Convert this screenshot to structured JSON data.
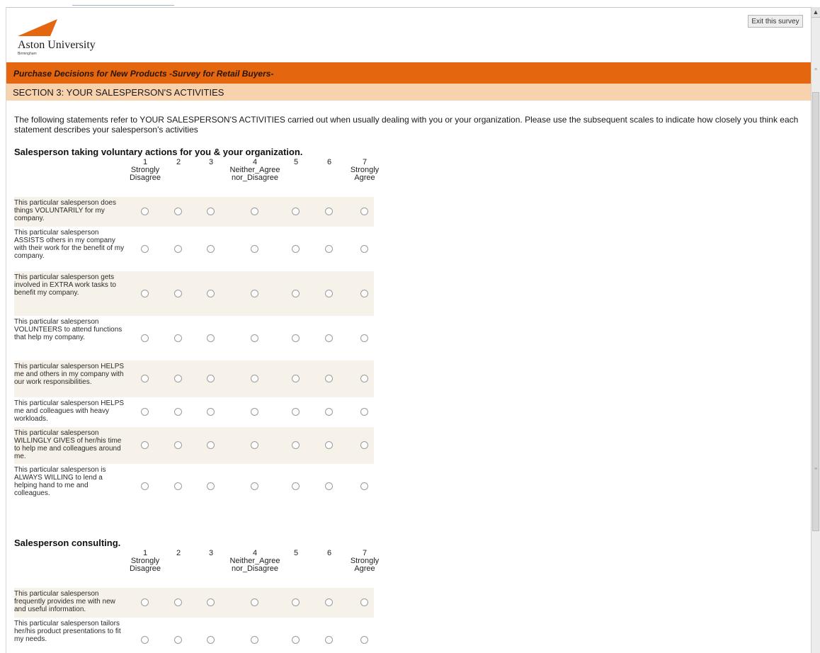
{
  "logo": {
    "name": "Aston University",
    "city": "Birmingham"
  },
  "exit_button": "Exit this survey",
  "survey_title": "Purchase Decisions for New Products -Survey for Retail Buyers-",
  "section_title": "SECTION 3: YOUR SALESPERSON'S ACTIVITIES",
  "intro_text": "The following statements refer to YOUR SALESPERSON'S ACTIVITIES carried out when usually dealing with you or your organization. Please use the subsequent scales to indicate how closely you think each statement describes your salesperson's activities",
  "scale": [
    {
      "num": "1",
      "label": "Strongly Disagree"
    },
    {
      "num": "2",
      "label": ""
    },
    {
      "num": "3",
      "label": ""
    },
    {
      "num": "4",
      "label": "Neither_Agree nor_Disagree"
    },
    {
      "num": "5",
      "label": ""
    },
    {
      "num": "6",
      "label": ""
    },
    {
      "num": "7",
      "label": "Strongly Agree"
    }
  ],
  "question_1": {
    "title": "Salesperson taking voluntary actions for you & your organization.",
    "statements": [
      "This particular salesperson does things VOLUNTARILY for my company.",
      "This particular salesperson ASSISTS others in my company with their work for the benefit of my company.",
      "This particular salesperson gets involved in EXTRA work tasks to benefit my company.",
      "This particular salesperson VOLUNTEERS to attend functions that help my company.",
      "This particular salesperson HELPS me and others in my company with our work responsibilities.",
      "This particular salesperson HELPS me and colleagues with heavy workloads.",
      "This particular salesperson WILLINGLY GIVES of her/his time to help me and colleagues around me.",
      "This particular salesperson is ALWAYS WILLING to lend a helping hand to me and colleagues."
    ]
  },
  "question_2": {
    "title": "Salesperson consulting.",
    "statements": [
      "This particular salesperson frequently provides me with new and useful information.",
      "This particular salesperson tailors her/his product presentations to fit my needs."
    ]
  },
  "colors": {
    "accent_orange": "#e4660e",
    "section_peach": "#f8d1ad",
    "row_shade": "#f6f2e9"
  },
  "icons": [
    "scroll-up-arrow-icon",
    "aston-logo-triangle-icon"
  ]
}
